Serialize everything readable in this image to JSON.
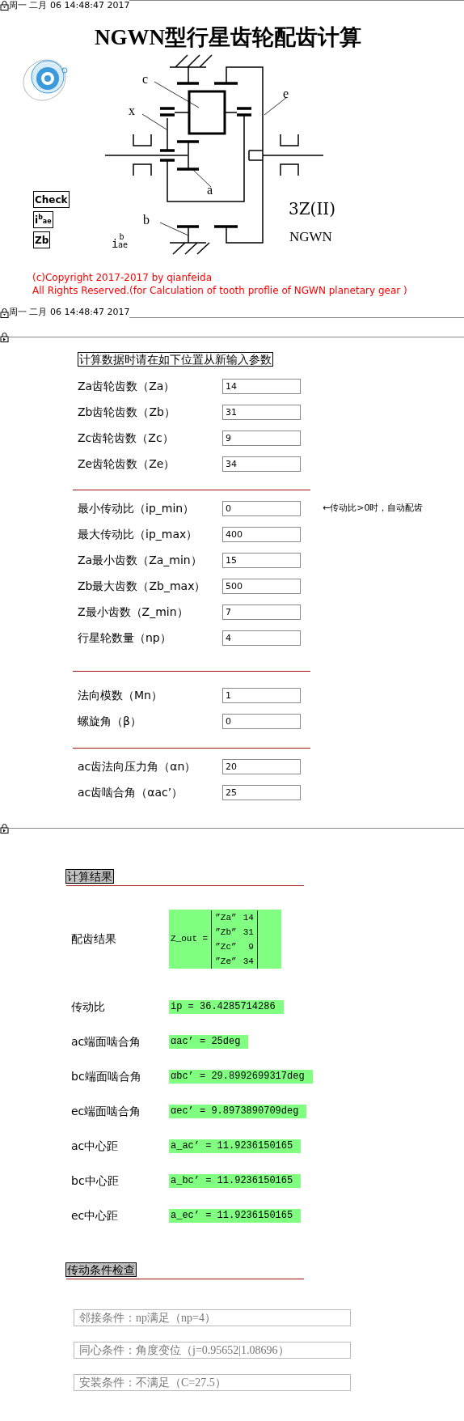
{
  "header_bars": [
    {
      "timestamp": "周一 二月 06 14:48:47 2017",
      "kind": "top"
    },
    {
      "timestamp": "周一 二月 06 14:48:47 2017",
      "kind": "bottom"
    }
  ],
  "title": "NGWN型行星齿轮配齿计算",
  "diagram": {
    "labels": [
      "c",
      "x",
      "e",
      "a",
      "b"
    ],
    "type_code": "3Z(II)",
    "type_name": "NGWN",
    "ratio_symbol": {
      "base": "i",
      "sup": "b",
      "sub": "ae"
    }
  },
  "buttons": [
    {
      "kind": "text",
      "label": "Check"
    },
    {
      "kind": "ratio",
      "base": "i",
      "sup": "b",
      "sub": "ae"
    },
    {
      "kind": "text",
      "label": "Zb"
    }
  ],
  "copyright": [
    "(c)Copyright 2017-2017 by qianfeida",
    "All Rights Reserved.(for Calculation of tooth proflie of NGWN planetary gear )"
  ],
  "input_section": {
    "heading": "计算数据时请在如下位置从新输入参数",
    "groups": [
      [
        {
          "label": "Za齿轮齿数（Za）",
          "value": "14"
        },
        {
          "label": "Zb齿轮齿数（Zb）",
          "value": "31"
        },
        {
          "label": "Zc齿轮齿数（Zc）",
          "value": "9"
        },
        {
          "label": "Ze齿轮齿数（Ze）",
          "value": "34"
        }
      ],
      [
        {
          "label": "最小传动比（ip_min）",
          "value": "0",
          "note": "←传动比>0时，自动配齿"
        },
        {
          "label": "最大传动比（ip_max）",
          "value": "400"
        },
        {
          "label": "Za最小齿数（Za_min）",
          "value": "15"
        },
        {
          "label": "Zb最大齿数（Zb_max）",
          "value": "500"
        },
        {
          "label": "Z最小齿数（Z_min）",
          "value": "7"
        },
        {
          "label": "行星轮数量（np）",
          "value": "4"
        }
      ],
      [
        {
          "label": "法向模数（Mn）",
          "value": "1"
        },
        {
          "label": "螺旋角（β）",
          "value": "0"
        }
      ],
      [
        {
          "label": "ac齿法向压力角（αn）",
          "value": "20"
        },
        {
          "label": "ac齿啮合角（αac’）",
          "value": "25"
        }
      ]
    ]
  },
  "results": {
    "heading": "计算结果",
    "matrix": {
      "label": "配齿结果",
      "lhs": "Z_out =",
      "rows": [
        [
          "”Za”",
          "14"
        ],
        [
          "”Zb”",
          "31"
        ],
        [
          "”Zc”",
          "9"
        ],
        [
          "”Ze”",
          "34"
        ]
      ]
    },
    "items": [
      {
        "label": "传动比",
        "value": "ip = 36.4285714286"
      },
      {
        "label": "ac端面啮合角",
        "value": "αac’ = 25deg"
      },
      {
        "label": "bc端面啮合角",
        "value": "αbc’ = 29.8992699317deg"
      },
      {
        "label": "ec端面啮合角",
        "value": "αec’ = 9.8973890709deg"
      },
      {
        "label": "ac中心距",
        "value": "a_ac’ = 11.9236150165"
      },
      {
        "label": "bc中心距",
        "value": "a_bc’ = 11.9236150165"
      },
      {
        "label": "ec中心距",
        "value": "a_ec’ = 11.9236150165"
      }
    ]
  },
  "checks": {
    "heading": "传动条件检查",
    "items": [
      "邻接条件：np满足（np=4）",
      "同心条件：角度变位（j=0.95652|1.08696）",
      "安装条件：不满足（C=27.5）"
    ]
  }
}
